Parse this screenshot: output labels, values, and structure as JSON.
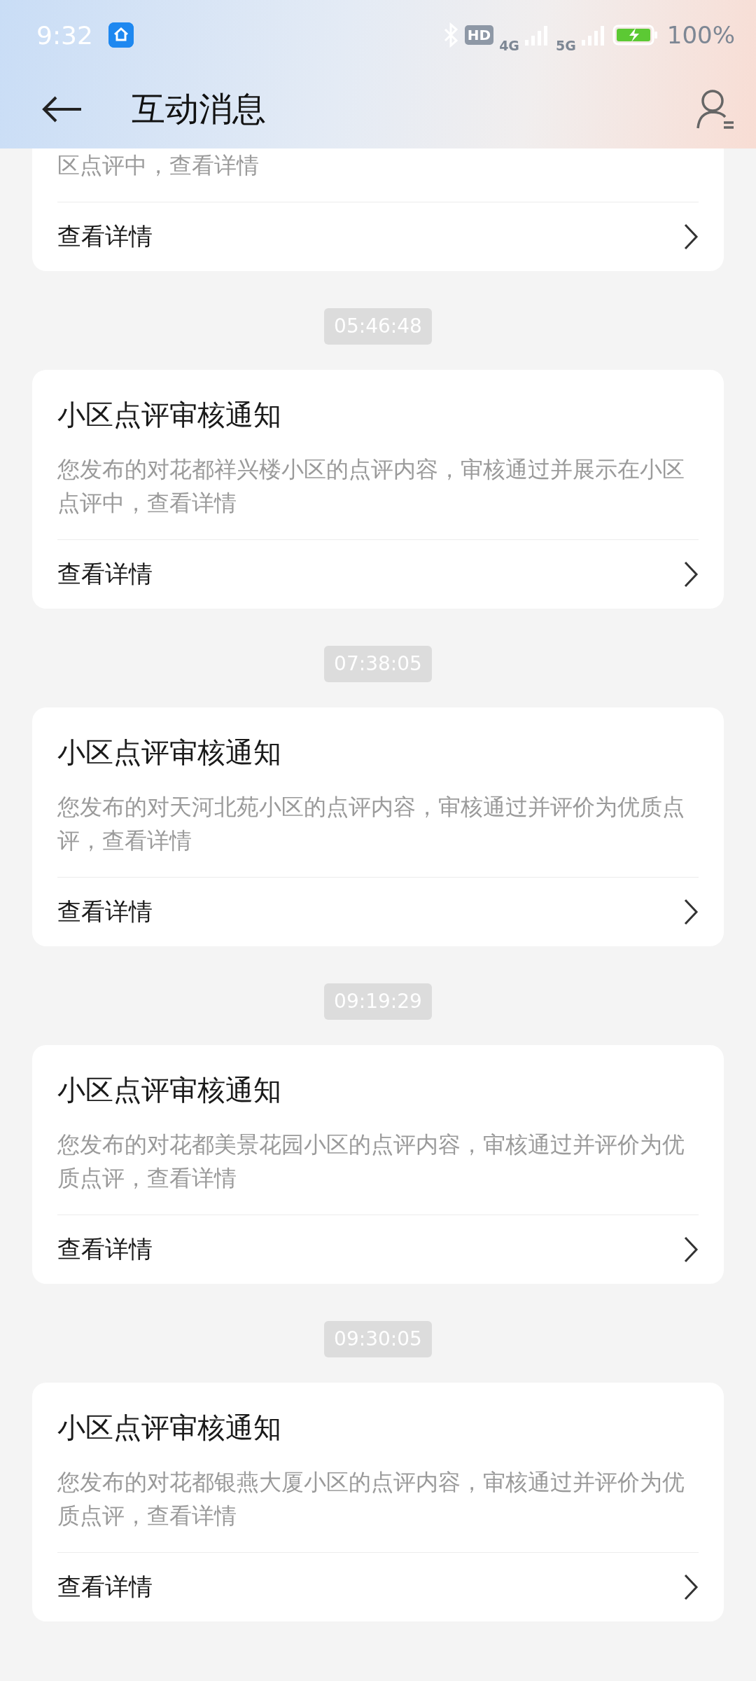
{
  "status_bar": {
    "time": "9:32",
    "hd_label": "HD",
    "network_1": "4G",
    "network_2": "5G",
    "battery": "100%"
  },
  "header": {
    "title": "互动消息"
  },
  "messages": [
    {
      "description": "区点评中，查看详情",
      "action": "查看详情"
    },
    {
      "time": "05:46:48",
      "title": "小区点评审核通知",
      "description": "您发布的对花都祥兴楼小区的点评内容，审核通过并展示在小区点评中，查看详情",
      "action": "查看详情"
    },
    {
      "time": "07:38:05",
      "title": "小区点评审核通知",
      "description": "您发布的对天河北苑小区的点评内容，审核通过并评价为优质点评，查看详情",
      "action": "查看详情"
    },
    {
      "time": "09:19:29",
      "title": "小区点评审核通知",
      "description": "您发布的对花都美景花园小区的点评内容，审核通过并评价为优质点评，查看详情",
      "action": "查看详情"
    },
    {
      "time": "09:30:05",
      "title": "小区点评审核通知",
      "description": "您发布的对花都银燕大厦小区的点评内容，审核通过并评价为优质点评，查看详情",
      "action": "查看详情"
    }
  ]
}
